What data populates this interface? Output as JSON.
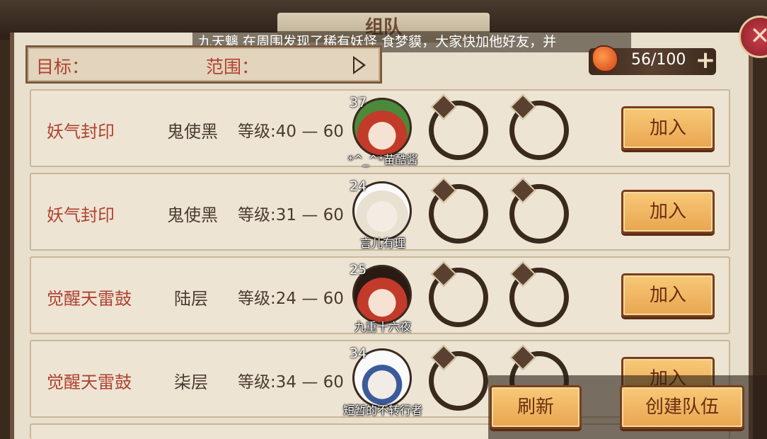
{
  "window": {
    "title": "组队",
    "marquee": "九天魑 在周围发现了稀有妖怪 食梦貘，大家快加他好友，并"
  },
  "filter": {
    "target_label": "目标：",
    "range_label": "范围："
  },
  "stamina": {
    "value": "56/100",
    "plus": "+"
  },
  "rows": [
    {
      "target": "妖气封印",
      "sub": "鬼使黑",
      "level": "等级:40 — 60",
      "avatar_level": "37",
      "avatar_name": "*^_^*苗酷酱",
      "join": "加入"
    },
    {
      "target": "妖气封印",
      "sub": "鬼使黑",
      "level": "等级:31 — 60",
      "avatar_level": "24",
      "avatar_name": "言儿有理",
      "join": "加入"
    },
    {
      "target": "觉醒天雷鼓",
      "sub": "陆层",
      "level": "等级:24 — 60",
      "avatar_level": "25",
      "avatar_name": "九重十六夜",
      "join": "加入"
    },
    {
      "target": "觉醒天雷鼓",
      "sub": "柒层",
      "level": "等级:34 — 60",
      "avatar_level": "34",
      "avatar_name": "短暂的不转行者",
      "join": "加入"
    }
  ],
  "actions": {
    "refresh": "刷新",
    "create_team": "创建队伍"
  },
  "close_symbol": "✕"
}
